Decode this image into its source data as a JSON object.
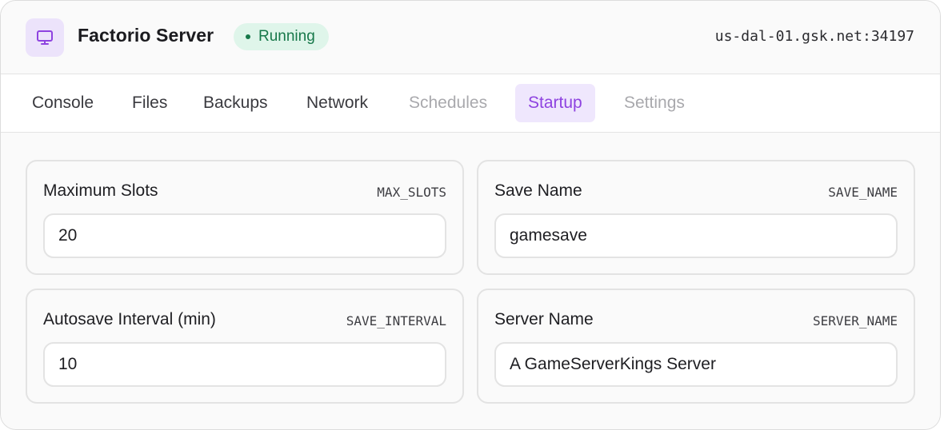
{
  "header": {
    "icon": "monitor-icon",
    "title": "Factorio Server",
    "status": "Running",
    "status_color": "#17784a",
    "address": "us-dal-01.gsk.net:34197"
  },
  "tabs": [
    {
      "label": "Console",
      "state": "normal"
    },
    {
      "label": "Files",
      "state": "normal"
    },
    {
      "label": "Backups",
      "state": "normal"
    },
    {
      "label": "Network",
      "state": "normal"
    },
    {
      "label": "Schedules",
      "state": "disabled"
    },
    {
      "label": "Startup",
      "state": "active"
    },
    {
      "label": "Settings",
      "state": "disabled"
    }
  ],
  "accent_color": "#8e43e0",
  "variables": [
    {
      "label": "Maximum Slots",
      "key": "MAX_SLOTS",
      "value": "20"
    },
    {
      "label": "Save Name",
      "key": "SAVE_NAME",
      "value": "gamesave"
    },
    {
      "label": "Autosave Interval (min)",
      "key": "SAVE_INTERVAL",
      "value": "10"
    },
    {
      "label": "Server Name",
      "key": "SERVER_NAME",
      "value": "A GameServerKings Server"
    }
  ]
}
